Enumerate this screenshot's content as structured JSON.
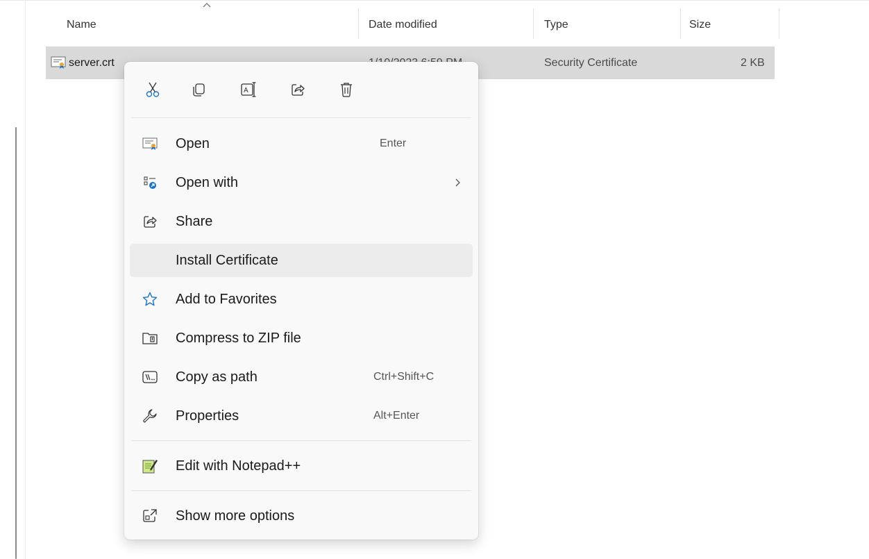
{
  "columns": {
    "name": "Name",
    "date_modified": "Date modified",
    "type": "Type",
    "size": "Size"
  },
  "file_row": {
    "name": "server.crt",
    "date_modified": "1/10/2023 6:59 PM",
    "type": "Security Certificate",
    "size": "2 KB",
    "icon": "certificate-icon"
  },
  "context_menu": {
    "quick_actions": [
      {
        "name": "cut",
        "icon": "scissors-icon"
      },
      {
        "name": "copy",
        "icon": "copy-icon"
      },
      {
        "name": "rename",
        "icon": "rename-icon"
      },
      {
        "name": "share",
        "icon": "share-icon"
      },
      {
        "name": "delete",
        "icon": "trash-icon"
      }
    ],
    "items": [
      {
        "label": "Open",
        "shortcut": "Enter",
        "icon": "certificate-icon"
      },
      {
        "label": "Open with",
        "icon": "open-with-icon",
        "submenu": true
      },
      {
        "label": "Share",
        "icon": "share-icon"
      },
      {
        "label": "Install Certificate",
        "highlighted": true
      },
      {
        "label": "Add to Favorites",
        "icon": "star-icon"
      },
      {
        "label": "Compress to ZIP file",
        "icon": "zip-icon"
      },
      {
        "label": "Copy as path",
        "shortcut": "Ctrl+Shift+C",
        "icon": "copy-path-icon"
      },
      {
        "label": "Properties",
        "shortcut": "Alt+Enter",
        "icon": "wrench-icon"
      },
      {
        "label": "Edit with Notepad++",
        "icon": "notepad-plus-plus-icon"
      },
      {
        "label": "Show more options",
        "icon": "show-more-icon"
      }
    ]
  },
  "colors": {
    "selection": "#d9d9d9",
    "menu_background": "#f9f9f9",
    "hover": "#ececec",
    "accent_blue": "#1a73c9"
  }
}
